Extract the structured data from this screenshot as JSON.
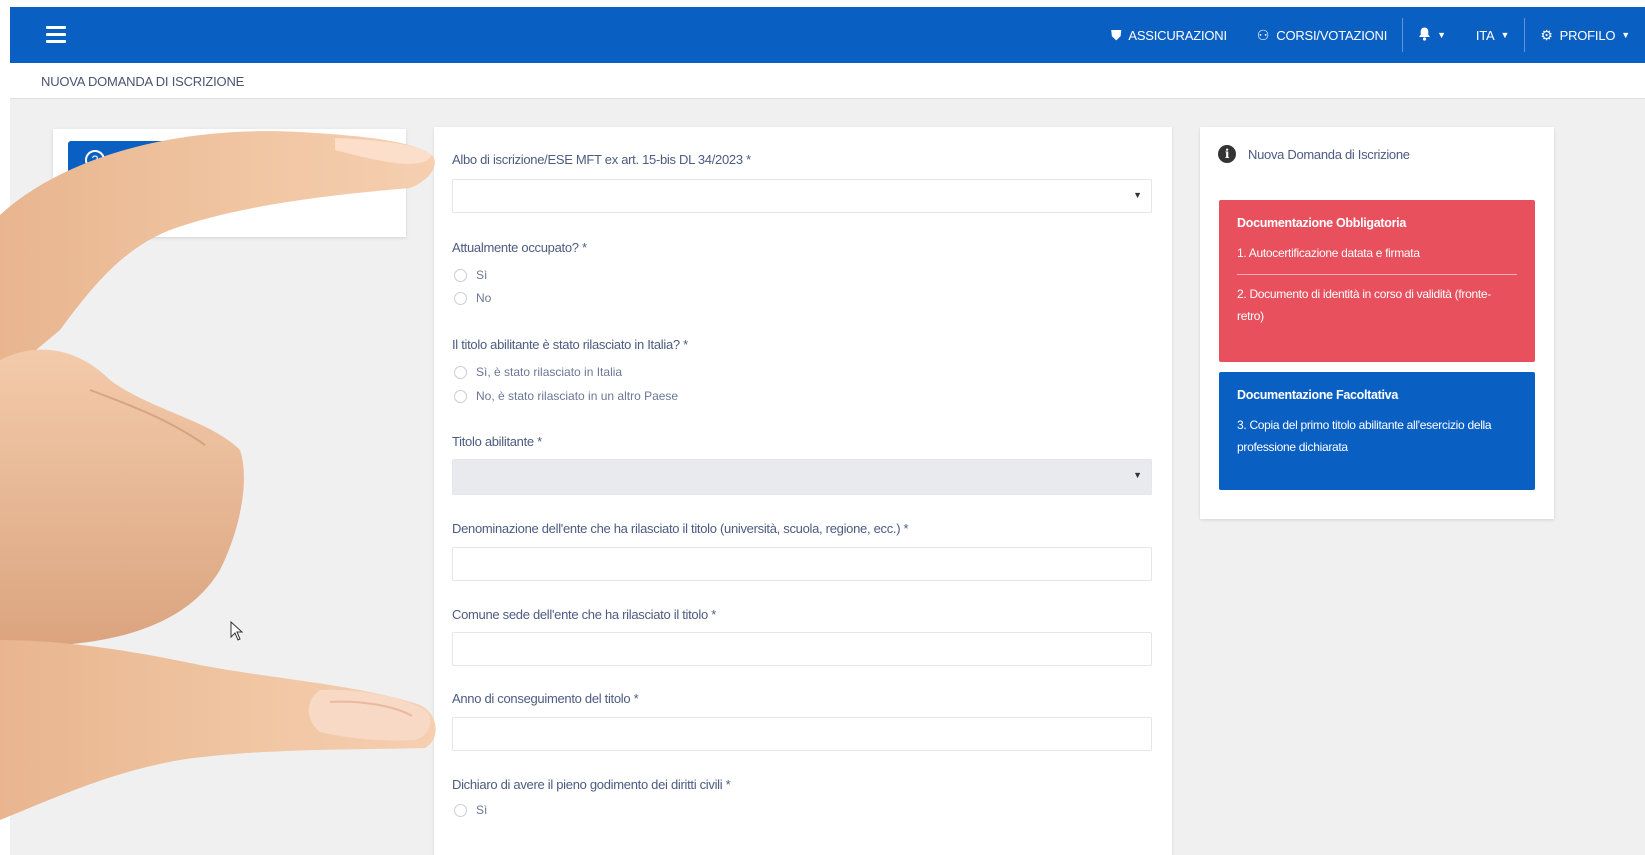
{
  "topbar": {
    "nav": [
      {
        "label": "ASSICURAZIONI",
        "icon": "shield-icon"
      },
      {
        "label": "CORSI/VOTAZIONI",
        "icon": "users-icon"
      },
      {
        "label": "",
        "icon": "bell-icon"
      },
      {
        "label": "ITA",
        "icon": ""
      },
      {
        "label": "PROFILO",
        "icon": "gear-icon"
      }
    ]
  },
  "breadcrumb": "NUOVA DOMANDA DI ISCRIZIONE",
  "form": {
    "albo_label": "Albo di iscrizione/ESE MFT ex art. 15-bis DL 34/2023 *",
    "occupato_label": "Attualmente occupato? *",
    "occupato_options": [
      "Sì",
      "No"
    ],
    "titolo_italia_label": "Il titolo abilitante è stato rilasciato in Italia? *",
    "titolo_italia_options": [
      "Sì, è stato rilasciato in Italia",
      "No, è stato rilasciato in un altro Paese"
    ],
    "titolo_label": "Titolo abilitante *",
    "ente_label": "Denominazione dell'ente che ha rilasciato il titolo (università, scuola, regione, ecc.) *",
    "comune_label": "Comune sede dell'ente che ha rilasciato il titolo *",
    "anno_label": "Anno di conseguimento del titolo *",
    "diritti_label": "Dichiaro di avere il pieno godimento dei diritti civili *",
    "diritti_options": [
      "Sì"
    ]
  },
  "side": {
    "title": "Nuova Domanda di Iscrizione",
    "obbligatoria": {
      "title": "Documentazione Obbligatoria",
      "items": [
        "1. Autocertificazione datata e firmata",
        "2. Documento di identità in corso di validità (fronte-retro)"
      ]
    },
    "facoltativa": {
      "title": "Documentazione Facoltativa",
      "items": [
        "3. Copia del primo titolo abilitante all'esercizio della professione dichiarata"
      ]
    }
  },
  "colors": {
    "primary": "#0a5fc3",
    "danger": "#e8505e"
  }
}
